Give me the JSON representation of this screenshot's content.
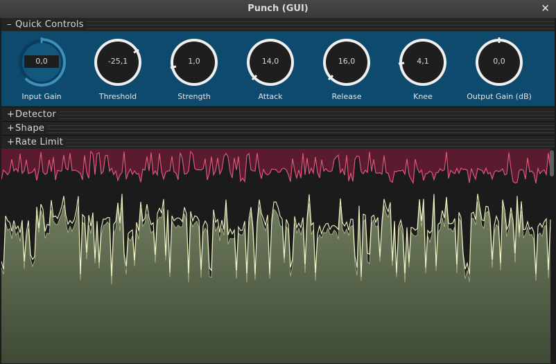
{
  "window": {
    "title": "Punch (GUI)",
    "close_icon": "close-icon"
  },
  "sections": {
    "quick_controls": {
      "sign": "–",
      "label": "Quick Controls"
    },
    "detector": {
      "sign": "+",
      "label": "Detector"
    },
    "shape": {
      "sign": "+",
      "label": "Shape"
    },
    "rate_limit": {
      "sign": "+",
      "label": "Rate Limit"
    }
  },
  "knobs": [
    {
      "label": "Input Gain",
      "value": "0,0"
    },
    {
      "label": "Threshold",
      "value": "-25,1"
    },
    {
      "label": "Strength",
      "value": "1,0"
    },
    {
      "label": "Attack",
      "value": "14,0"
    },
    {
      "label": "Release",
      "value": "16,0"
    },
    {
      "label": "Knee",
      "value": "4,1"
    },
    {
      "label": "Output Gain (dB)",
      "value": "0,0"
    }
  ],
  "colors": {
    "panel": "#0d4a6e",
    "knob_face": "#f0f0f0",
    "knob_center": "#1e1e1e",
    "gain_reduction": "#e2557f",
    "signal_line": "#f2f7c6"
  }
}
